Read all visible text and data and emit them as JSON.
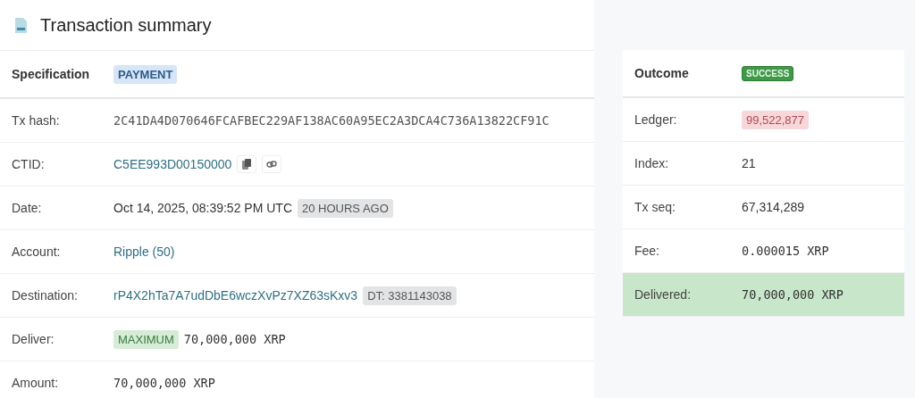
{
  "title": "Transaction summary",
  "main": {
    "header": {
      "label": "Specification",
      "parts": [
        {
          "kind": "tag-info",
          "text": "PAYMENT"
        }
      ]
    },
    "rows": [
      {
        "label": "Tx hash:",
        "parts": [
          {
            "kind": "hash",
            "text": "2C41DA4D070646FCAFBEC229AF138AC60A95EC2A3DCA4C736A13822CF91C"
          }
        ]
      },
      {
        "label": "CTID:",
        "parts": [
          {
            "kind": "link",
            "text": "C5EE993D00150000"
          },
          {
            "kind": "copy"
          },
          {
            "kind": "chain"
          }
        ]
      },
      {
        "label": "Date:",
        "parts": [
          {
            "kind": "text",
            "text": "Oct 14, 2025, 08:39:52 PM UTC"
          },
          {
            "kind": "tag-muted",
            "text": "20 HOURS AGO"
          }
        ]
      },
      {
        "label": "Account:",
        "parts": [
          {
            "kind": "link",
            "text": "Ripple (50)"
          }
        ]
      },
      {
        "label": "Destination:",
        "parts": [
          {
            "kind": "link",
            "text": "rP4X2hTa7A7udDbE6wczXvPz7XZ63sKxv3"
          },
          {
            "kind": "tag-muted",
            "text": "DT: 3381143038"
          }
        ]
      },
      {
        "label": "Deliver:",
        "parts": [
          {
            "kind": "tag-success",
            "text": "MAXIMUM"
          },
          {
            "kind": "amount",
            "text": "70,000,000 XRP"
          }
        ]
      },
      {
        "label": "Amount:",
        "parts": [
          {
            "kind": "amount",
            "text": "70,000,000 XRP"
          }
        ]
      }
    ]
  },
  "outcome": {
    "header": {
      "label": "Outcome",
      "parts": [
        {
          "kind": "tag-solid",
          "text": "SUCCESS"
        }
      ]
    },
    "rows": [
      {
        "label": "Ledger:",
        "highlighted": false,
        "parts": [
          {
            "kind": "tag-danger",
            "text": "99,522,877"
          }
        ]
      },
      {
        "label": "Index:",
        "highlighted": false,
        "parts": [
          {
            "kind": "text",
            "text": "21"
          }
        ]
      },
      {
        "label": "Tx seq:",
        "highlighted": false,
        "parts": [
          {
            "kind": "text",
            "text": "67,314,289"
          }
        ]
      },
      {
        "label": "Fee:",
        "highlighted": false,
        "parts": [
          {
            "kind": "amount",
            "text": "0.000015 XRP"
          }
        ]
      },
      {
        "label": "Delivered:",
        "highlighted": true,
        "parts": [
          {
            "kind": "amount",
            "text": "70,000,000 XRP"
          }
        ]
      }
    ]
  }
}
